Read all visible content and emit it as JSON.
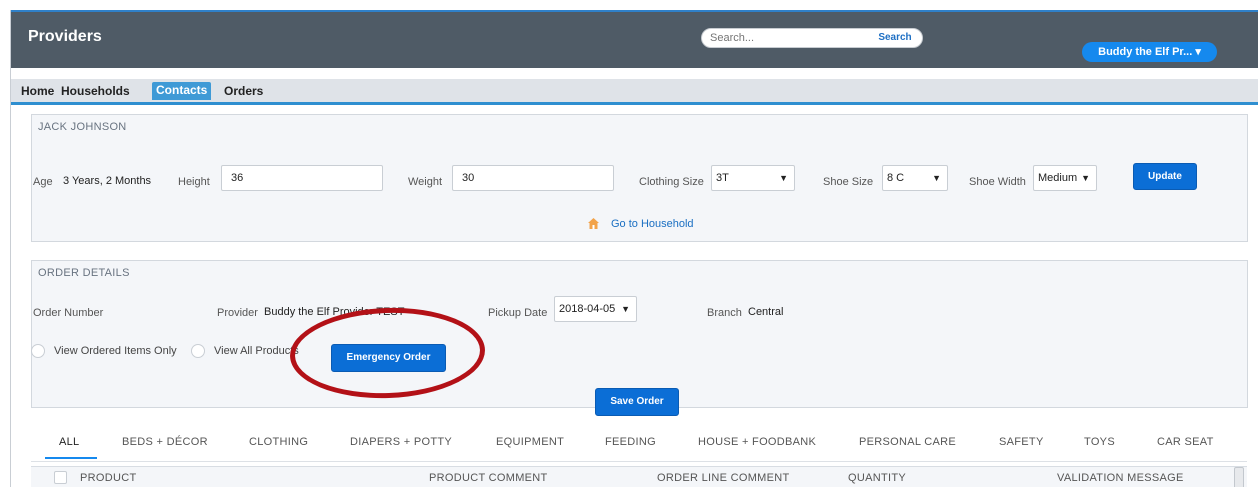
{
  "header": {
    "title": "Providers",
    "search_placeholder": "Search...",
    "search_button": "Search",
    "user_menu": "Buddy the Elf Pr... ▾"
  },
  "nav": {
    "items": [
      "Home",
      "Households",
      "Contacts",
      "Orders"
    ],
    "active": "Contacts"
  },
  "contact": {
    "name": "JACK JOHNSON",
    "age_label": "Age",
    "age_value": "3 Years, 2 Months",
    "height_label": "Height",
    "height_value": "36",
    "weight_label": "Weight",
    "weight_value": "30",
    "clothing_label": "Clothing Size",
    "clothing_value": "3T",
    "shoe_size_label": "Shoe Size",
    "shoe_size_value": "8 C",
    "shoe_width_label": "Shoe Width",
    "shoe_width_value": "Medium",
    "update_button": "Update",
    "household_link": "Go to Household"
  },
  "order": {
    "title": "ORDER DETAILS",
    "order_number_label": "Order Number",
    "provider_label": "Provider",
    "provider_value": "Buddy the Elf Provider TEST",
    "pickup_label": "Pickup Date",
    "pickup_value": "2018-04-05",
    "branch_label": "Branch",
    "branch_value": "Central",
    "radio_ordered": "View Ordered Items Only",
    "radio_all": "View All Products",
    "emergency_button": "Emergency Order",
    "save_button": "Save Order"
  },
  "tabs": [
    "ALL",
    "BEDS + DÉCOR",
    "CLOTHING",
    "DIAPERS + POTTY",
    "EQUIPMENT",
    "FEEDING",
    "HOUSE + FOODBANK",
    "PERSONAL CARE",
    "SAFETY",
    "TOYS",
    "CAR SEAT"
  ],
  "table": {
    "columns": [
      "PRODUCT",
      "PRODUCT COMMENT",
      "ORDER LINE COMMENT",
      "QUANTITY",
      "VALIDATION MESSAGE"
    ]
  },
  "colors": {
    "header_bg": "#4f5b66",
    "accent": "#1589ee",
    "button": "#0b6ed6",
    "annotation_ring": "#b31117"
  },
  "icons": {
    "house": "house-icon",
    "dropdown": "chevron-down-icon"
  }
}
